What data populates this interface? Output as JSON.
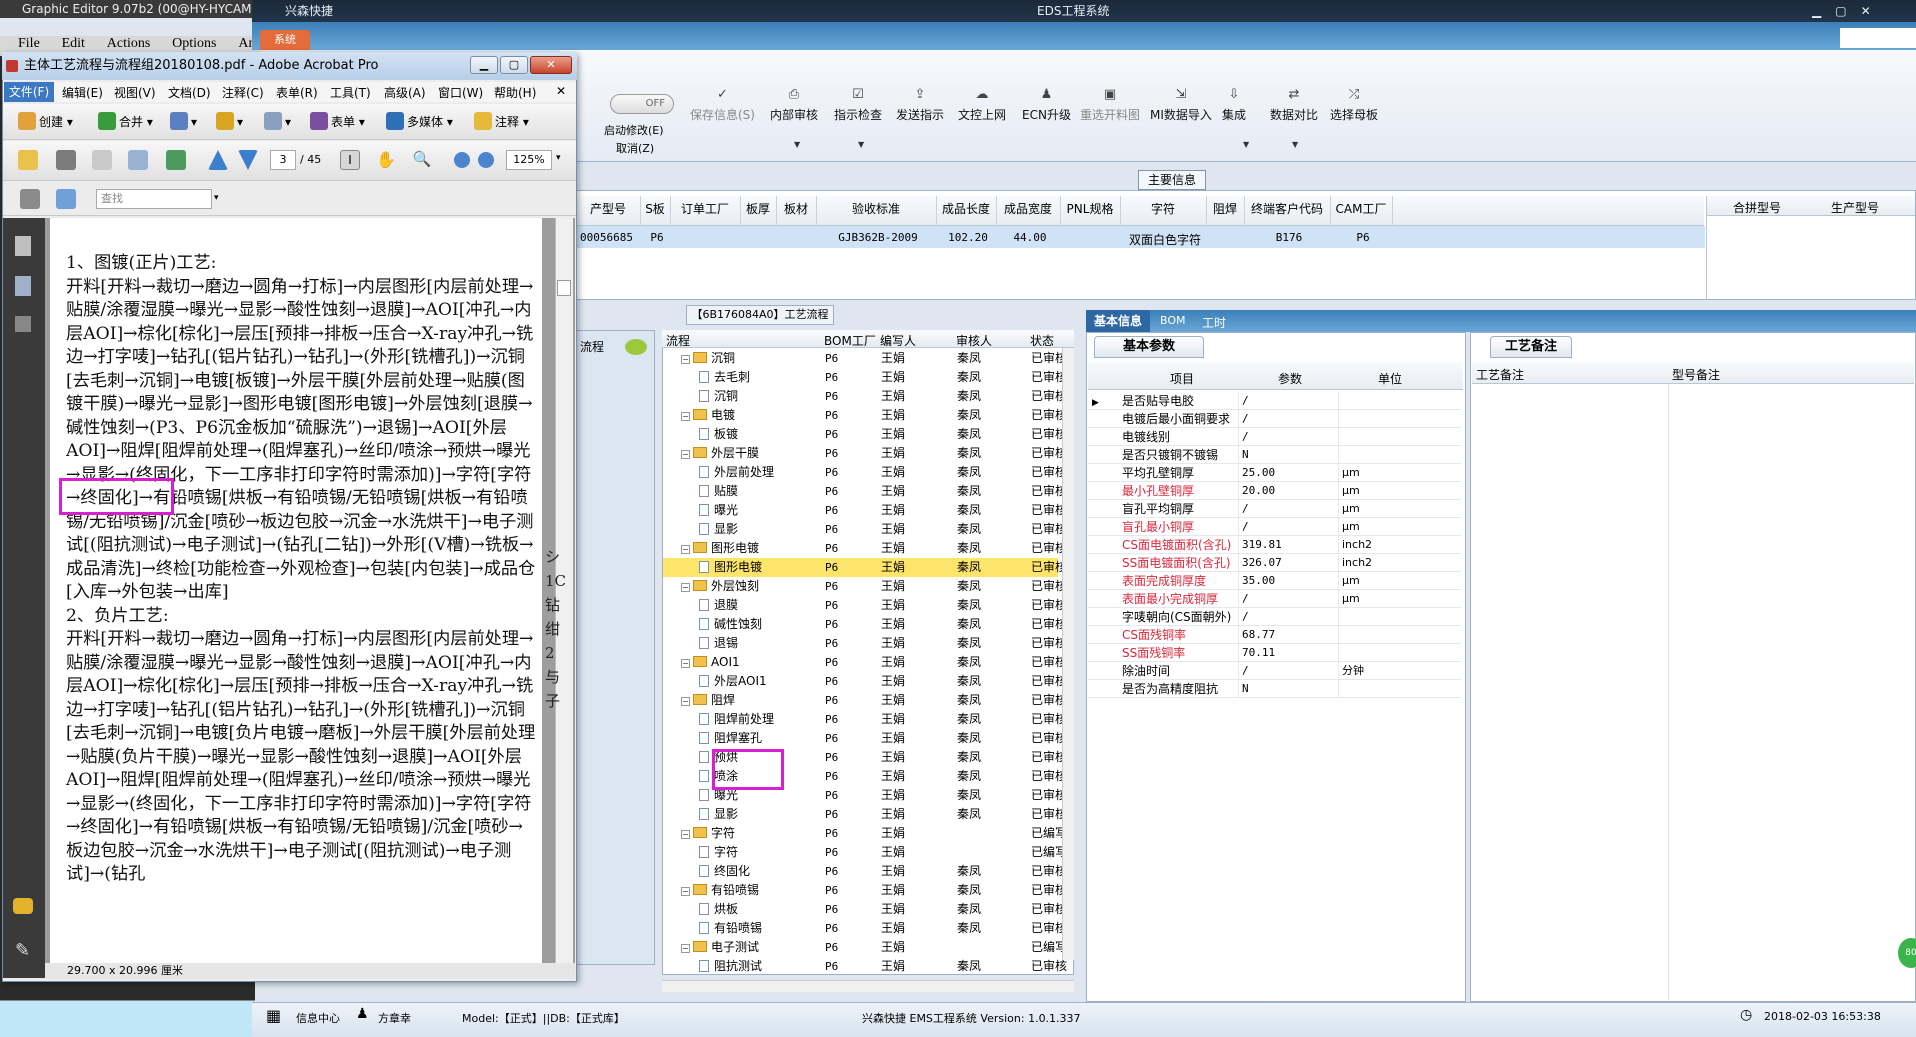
{
  "graphic_editor": {
    "title": "Graphic Editor 9.07b2 (00@HY-HYCAM",
    "menu": [
      "File",
      "Edit",
      "Actions",
      "Options",
      "An"
    ]
  },
  "ems": {
    "title": "EDS工程系统",
    "app_tab": "兴森快捷",
    "system_tab": "系统",
    "toggle": {
      "state": "OFF",
      "label": "启动修改(E)",
      "cancel": "取消(Z)"
    },
    "toolbar": [
      {
        "label": "保存信息(S)",
        "icon": "check-icon",
        "enabled": false
      },
      {
        "label": "内部审核",
        "icon": "printer-icon",
        "enabled": true
      },
      {
        "label": "指示检查",
        "icon": "checklist-icon",
        "enabled": true
      },
      {
        "label": "发送指示",
        "icon": "upload-icon",
        "enabled": true
      },
      {
        "label": "文控上网",
        "icon": "cloud-icon",
        "enabled": true
      },
      {
        "label": "ECN升级",
        "icon": "people-icon",
        "enabled": true
      },
      {
        "label": "重选开料图",
        "icon": "image-icon",
        "enabled": false
      },
      {
        "label": "MI数据导入",
        "icon": "import-icon",
        "enabled": true
      },
      {
        "label": "集成",
        "icon": "download-icon",
        "enabled": true
      },
      {
        "label": "数据对比",
        "icon": "compare-icon",
        "enabled": true
      },
      {
        "label": "选择母板",
        "icon": "shuffle-icon",
        "enabled": true
      }
    ],
    "main_info": {
      "section_label": "主要信息",
      "columns": [
        "产型号",
        "S板",
        "订单工厂",
        "板厚",
        "板材",
        "验收标准",
        "成品长度",
        "成品宽度",
        "PNL规格",
        "字符",
        "阻焊",
        "终端客户代码",
        "CAM工厂"
      ],
      "row": [
        "00056685",
        "P6",
        "",
        "",
        "",
        "GJB362B-2009",
        "102.20",
        "44.00",
        "",
        "双面白色字符",
        "",
        "B176",
        "P6"
      ],
      "right_columns": [
        "合拼型号",
        "生产型号"
      ]
    },
    "flow": {
      "tab_label": "【6B176084A0】工艺流程",
      "left_label": "流程",
      "columns": [
        "流程",
        "BOM工厂",
        "编写人",
        "审核人",
        "状态"
      ],
      "rows": [
        {
          "level": 0,
          "name": "沉铜",
          "bom": "P6",
          "writer": "王娟",
          "reviewer": "秦凤",
          "status": "已审核"
        },
        {
          "level": 1,
          "name": "去毛刺",
          "bom": "P6",
          "writer": "王娟",
          "reviewer": "秦凤",
          "status": "已审核"
        },
        {
          "level": 1,
          "name": "沉铜",
          "bom": "P6",
          "writer": "王娟",
          "reviewer": "秦凤",
          "status": "已审核"
        },
        {
          "level": 0,
          "name": "电镀",
          "bom": "P6",
          "writer": "王娟",
          "reviewer": "秦凤",
          "status": "已审核"
        },
        {
          "level": 1,
          "name": "板镀",
          "bom": "P6",
          "writer": "王娟",
          "reviewer": "秦凤",
          "status": "已审核"
        },
        {
          "level": 0,
          "name": "外层干膜",
          "bom": "P6",
          "writer": "王娟",
          "reviewer": "秦凤",
          "status": "已审核"
        },
        {
          "level": 1,
          "name": "外层前处理",
          "bom": "P6",
          "writer": "王娟",
          "reviewer": "秦凤",
          "status": "已审核"
        },
        {
          "level": 1,
          "name": "贴膜",
          "bom": "P6",
          "writer": "王娟",
          "reviewer": "秦凤",
          "status": "已审核"
        },
        {
          "level": 1,
          "name": "曝光",
          "bom": "P6",
          "writer": "王娟",
          "reviewer": "秦凤",
          "status": "已审核"
        },
        {
          "level": 1,
          "name": "显影",
          "bom": "P6",
          "writer": "王娟",
          "reviewer": "秦凤",
          "status": "已审核"
        },
        {
          "level": 0,
          "name": "图形电镀",
          "bom": "P6",
          "writer": "王娟",
          "reviewer": "秦凤",
          "status": "已审核"
        },
        {
          "level": 1,
          "name": "图形电镀",
          "bom": "P6",
          "writer": "王娟",
          "reviewer": "秦凤",
          "status": "已审核",
          "highlight": true
        },
        {
          "level": 0,
          "name": "外层蚀刻",
          "bom": "P6",
          "writer": "王娟",
          "reviewer": "秦凤",
          "status": "已审核"
        },
        {
          "level": 1,
          "name": "退膜",
          "bom": "P6",
          "writer": "王娟",
          "reviewer": "秦凤",
          "status": "已审核"
        },
        {
          "level": 1,
          "name": "碱性蚀刻",
          "bom": "P6",
          "writer": "王娟",
          "reviewer": "秦凤",
          "status": "已审核"
        },
        {
          "level": 1,
          "name": "退锡",
          "bom": "P6",
          "writer": "王娟",
          "reviewer": "秦凤",
          "status": "已审核"
        },
        {
          "level": 0,
          "name": "AOI1",
          "bom": "P6",
          "writer": "王娟",
          "reviewer": "秦凤",
          "status": "已审核"
        },
        {
          "level": 1,
          "name": "外层AOI1",
          "bom": "P6",
          "writer": "王娟",
          "reviewer": "秦凤",
          "status": "已审核"
        },
        {
          "level": 0,
          "name": "阻焊",
          "bom": "P6",
          "writer": "王娟",
          "reviewer": "秦凤",
          "status": "已审核"
        },
        {
          "level": 1,
          "name": "阻焊前处理",
          "bom": "P6",
          "writer": "王娟",
          "reviewer": "秦凤",
          "status": "已审核"
        },
        {
          "level": 1,
          "name": "阻焊塞孔",
          "bom": "P6",
          "writer": "王娟",
          "reviewer": "秦凤",
          "status": "已审核"
        },
        {
          "level": 1,
          "name": "预烘",
          "bom": "P6",
          "writer": "王娟",
          "reviewer": "秦凤",
          "status": "已审核"
        },
        {
          "level": 1,
          "name": "喷涂",
          "bom": "P6",
          "writer": "王娟",
          "reviewer": "秦凤",
          "status": "已审核"
        },
        {
          "level": 1,
          "name": "曝光",
          "bom": "P6",
          "writer": "王娟",
          "reviewer": "秦凤",
          "status": "已审核"
        },
        {
          "level": 1,
          "name": "显影",
          "bom": "P6",
          "writer": "王娟",
          "reviewer": "秦凤",
          "status": "已审核"
        },
        {
          "level": 0,
          "name": "字符",
          "bom": "P6",
          "writer": "王娟",
          "reviewer": "",
          "status": "已编写"
        },
        {
          "level": 1,
          "name": "字符",
          "bom": "P6",
          "writer": "王娟",
          "reviewer": "",
          "status": "已编写"
        },
        {
          "level": 1,
          "name": "终固化",
          "bom": "P6",
          "writer": "王娟",
          "reviewer": "秦凤",
          "status": "已审核"
        },
        {
          "level": 0,
          "name": "有铅喷锡",
          "bom": "P6",
          "writer": "王娟",
          "reviewer": "秦凤",
          "status": "已审核"
        },
        {
          "level": 1,
          "name": "烘板",
          "bom": "P6",
          "writer": "王娟",
          "reviewer": "秦凤",
          "status": "已审核"
        },
        {
          "level": 1,
          "name": "有铅喷锡",
          "bom": "P6",
          "writer": "王娟",
          "reviewer": "秦凤",
          "status": "已审核"
        },
        {
          "level": 0,
          "name": "电子测试",
          "bom": "P6",
          "writer": "王娟",
          "reviewer": "",
          "status": "已编写"
        },
        {
          "level": 1,
          "name": "阻抗测试",
          "bom": "P6",
          "writer": "王娟",
          "reviewer": "秦凤",
          "status": "已审核"
        }
      ]
    },
    "basic": {
      "tabs": [
        "基本信息",
        "BOM",
        "工时"
      ],
      "panel_label": "基本参数",
      "columns": [
        "项目",
        "参数",
        "单位"
      ],
      "rows": [
        {
          "item": "是否贴导电胶",
          "value": "/",
          "unit": "",
          "red": false
        },
        {
          "item": "电镀后最小面铜要求",
          "value": "/",
          "unit": "",
          "red": false
        },
        {
          "item": "电镀线别",
          "value": "/",
          "unit": "",
          "red": false
        },
        {
          "item": "是否只镀铜不镀锡",
          "value": "N",
          "unit": "",
          "red": false
        },
        {
          "item": "平均孔壁铜厚",
          "value": "25.00",
          "unit": "μm",
          "red": false
        },
        {
          "item": "最小孔壁铜厚",
          "value": "20.00",
          "unit": "μm",
          "red": true
        },
        {
          "item": "盲孔平均铜厚",
          "value": "/",
          "unit": "μm",
          "red": false
        },
        {
          "item": "盲孔最小铜厚",
          "value": "/",
          "unit": "μm",
          "red": true
        },
        {
          "item": "CS面电镀面积(含孔)",
          "value": "319.81",
          "unit": "inch2",
          "red": true
        },
        {
          "item": "SS面电镀面积(含孔)",
          "value": "326.07",
          "unit": "inch2",
          "red": true
        },
        {
          "item": "表面完成铜厚度",
          "value": "35.00",
          "unit": "μm",
          "red": true
        },
        {
          "item": "表面最小完成铜厚",
          "value": "/",
          "unit": "μm",
          "red": true
        },
        {
          "item": "字唛朝向(CS面朝外)",
          "value": "/",
          "unit": "",
          "red": false
        },
        {
          "item": "CS面残铜率",
          "value": "68.77",
          "unit": "",
          "red": true
        },
        {
          "item": "SS面残铜率",
          "value": "70.11",
          "unit": "",
          "red": true
        },
        {
          "item": "除油时间",
          "value": "/",
          "unit": "分钟",
          "red": false
        },
        {
          "item": "是否为高精度阻抗",
          "value": "N",
          "unit": "",
          "red": false
        }
      ]
    },
    "remark": {
      "panel_label": "工艺备注",
      "columns": [
        "工艺备注",
        "型号备注"
      ]
    },
    "status": {
      "info_center": "信息中心",
      "user": "方章幸",
      "model": "Model:【正式】||DB:【正式库】",
      "system": "兴森快捷 EMS工程系统 Version: 1.0.1.337",
      "datetime": "2018-02-03 16:53:38",
      "badge": "80"
    }
  },
  "acrobat": {
    "title": "主体工艺流程与流程组20180108.pdf - Adobe Acrobat Pro",
    "menu": [
      "文件(F)",
      "编辑(E)",
      "视图(V)",
      "文档(D)",
      "注释(C)",
      "表单(R)",
      "工具(T)",
      "高级(A)",
      "窗口(W)",
      "帮助(H)"
    ],
    "toolbar1": [
      "创建",
      "合并",
      "表单",
      "多媒体",
      "注释"
    ],
    "page_current": "3",
    "page_total": "/ 45",
    "zoom": "125%",
    "find_placeholder": "查找",
    "page_size": "29.700 x 20.996 厘米",
    "doc_text": "1、图镀(正片)工艺:\n开料[开料→裁切→磨边→圆角→打标]→内层图形[内层前处理→贴膜/涂覆湿膜→曝光→显影→酸性蚀刻→退膜]→AOI[冲孔→内层AOI]→棕化[棕化]→层压[预排→排板→压合→X-ray冲孔→铣边→打字唛]→钻孔[(铝片钻孔)→钻孔]→(外形[铣槽孔])→沉铜[去毛刺→沉铜]→电镀[板镀]→外层干膜[外层前处理→贴膜(图镀干膜)→曝光→显影]→图形电镀[图形电镀]→外层蚀刻[退膜→碱性蚀刻→(P3、P6沉金板加“硫脲洗”)→退锡]→AOI[外层AOI]→阻焊[阻焊前处理→(阻焊塞孔)→丝印/喷涂→预烘→曝光→显影→(终固化，下一工序非打印字符时需添加)]→字符[字符→终固化]→有铅喷锡[烘板→有铅喷锡/无铅喷锡[烘板→有铅喷锡/无铅喷锡]/沉金[喷砂→板边包胶→沉金→水洗烘干]→电子测试[(阻抗测试)→电子测试]→(钻孔[二钻])→外形[(V槽)→铣板→成品清洗]→终检[功能检查→外观检查]→包装[内包装]→成品仓[入库→外包装→出库]\n2、负片工艺:\n开料[开料→裁切→磨边→圆角→打标]→内层图形[内层前处理→贴膜/涂覆湿膜→曝光→显影→酸性蚀刻→退膜]→AOI[冲孔→内层AOI]→棕化[棕化]→层压[预排→排板→压合→X-ray冲孔→铣边→打字唛]→钻孔[(铝片钻孔)→钻孔]→(外形[铣槽孔])→沉铜[去毛刺→沉铜]→电镀[负片电镀→磨板]→外层干膜[外层前处理→贴膜(负片干膜)→曝光→显影→酸性蚀刻→退膜]→AOI[外层AOI]→阻焊[阻焊前处理→(阻焊塞孔)→丝印/喷涂→预烘→曝光→显影→(终固化，下一工序非打印字符时需添加)]→字符[字符→终固化]→有铅喷锡[烘板→有铅喷锡/无铅喷锡]/沉金[喷砂→板边包胶→沉金→水洗烘干]→电子测试[(阻抗测试)→电子测试]→(钻孔",
    "behind_chars": "シ1C钻绀2与子"
  }
}
